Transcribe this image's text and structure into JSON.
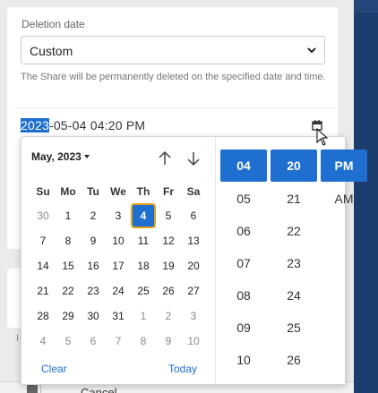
{
  "form": {
    "deletion_label": "Deletion date",
    "select_value": "Custom",
    "help_text": "The Share will be permanently deleted on the specified date and time.",
    "datetime_selected": "2023",
    "datetime_rest": "-05-04 04:20 PM"
  },
  "picker": {
    "month_label": "May, 2023",
    "weekdays": [
      "Su",
      "Mo",
      "Tu",
      "We",
      "Th",
      "Fr",
      "Sa"
    ],
    "weeks": [
      [
        "30",
        "1",
        "2",
        "3",
        "4",
        "5",
        "6"
      ],
      [
        "7",
        "8",
        "9",
        "10",
        "11",
        "12",
        "13"
      ],
      [
        "14",
        "15",
        "16",
        "17",
        "18",
        "19",
        "20"
      ],
      [
        "21",
        "22",
        "23",
        "24",
        "25",
        "26",
        "27"
      ],
      [
        "28",
        "29",
        "30",
        "31",
        "1",
        "2",
        "3"
      ],
      [
        "4",
        "5",
        "6",
        "7",
        "8",
        "9",
        "10"
      ]
    ],
    "clear_label": "Clear",
    "today_label": "Today",
    "selected_hour": "04",
    "selected_minute": "20",
    "selected_period": "PM",
    "hours": [
      "05",
      "06",
      "07",
      "08",
      "09",
      "10"
    ],
    "minutes": [
      "21",
      "22",
      "23",
      "24",
      "25",
      "26"
    ],
    "periods": [
      "AM"
    ]
  },
  "footer": {
    "cancel_label": "Cancel"
  },
  "stub": {
    "letter": "I"
  },
  "colors": {
    "accent": "#1f6fd1",
    "highlight_ring": "#e0a21b",
    "sidebar": "#1b3e6e"
  }
}
